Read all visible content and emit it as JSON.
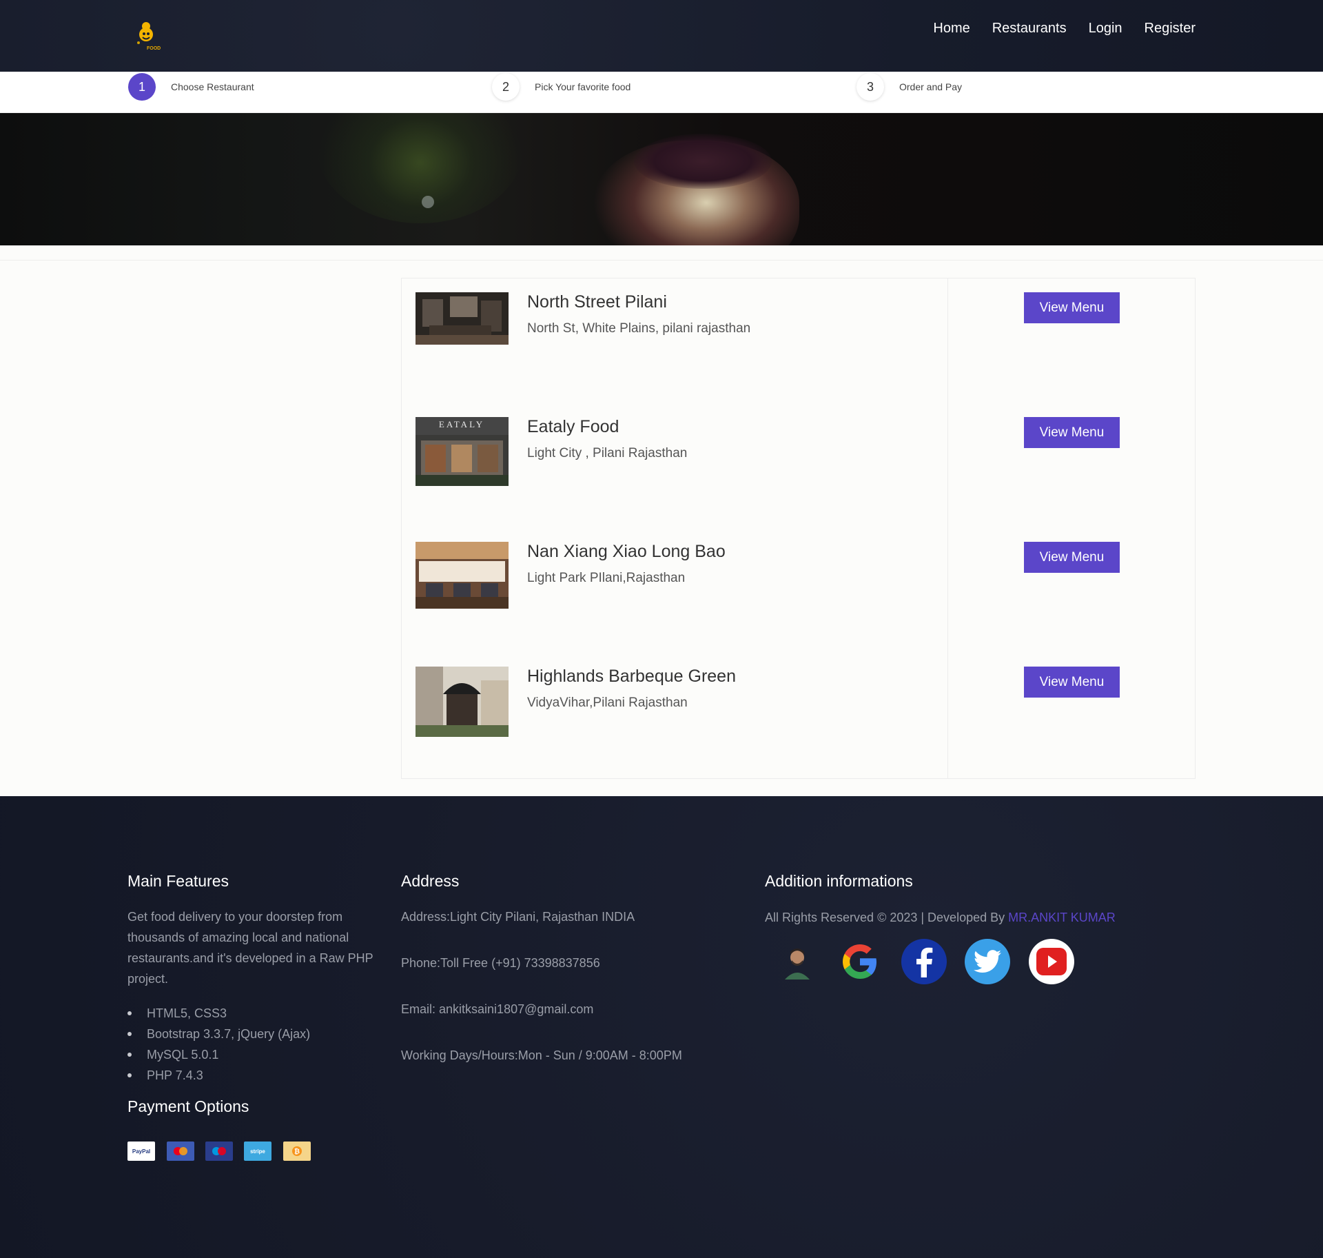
{
  "nav": {
    "links": [
      "Home",
      "Restaurants",
      "Login",
      "Register"
    ],
    "logo_text": "FOOD"
  },
  "steps": [
    {
      "num": "1",
      "label": "Choose Restaurant",
      "active": true
    },
    {
      "num": "2",
      "label": "Pick Your favorite food",
      "active": false
    },
    {
      "num": "3",
      "label": "Order and Pay",
      "active": false
    }
  ],
  "restaurants": [
    {
      "name": "North Street Pilani",
      "address": "North St, White Plains, pilani rajasthan",
      "button": "View Menu"
    },
    {
      "name": "Eataly Food",
      "address": "Light City , Pilani Rajasthan",
      "button": "View Menu",
      "thumb_text": "EATALY"
    },
    {
      "name": "Nan Xiang Xiao Long Bao",
      "address": "Light Park PIlani,Rajasthan",
      "button": "View Menu"
    },
    {
      "name": "Highlands Barbeque Green",
      "address": "VidyaVihar,Pilani Rajasthan",
      "button": "View Menu"
    }
  ],
  "footer": {
    "features": {
      "title": "Main Features",
      "text": "Get food delivery to your doorstep from thousands of amazing local and national restaurants.and it's developed in a Raw PHP project.",
      "items": [
        "HTML5, CSS3",
        "Bootstrap 3.3.7, jQuery (Ajax)",
        "MySQL 5.0.1",
        "PHP 7.4.3"
      ]
    },
    "payment": {
      "title": "Payment Options",
      "methods": [
        {
          "label": "PayPal",
          "icon": "paypal-icon"
        },
        {
          "label": "",
          "icon": "mastercard-icon"
        },
        {
          "label": "",
          "icon": "maestro-icon"
        },
        {
          "label": "stripe",
          "icon": "stripe-icon"
        },
        {
          "label": "",
          "icon": "bitcoin-icon"
        }
      ]
    },
    "address": {
      "title": "Address",
      "lines": [
        "Address:Light City Pilani, Rajasthan INDIA",
        "Phone:Toll Free (+91) 73398837856",
        "Email: ankitksaini1807@gmail.com",
        "Working Days/Hours:Mon - Sun / 9:00AM - 8:00PM"
      ]
    },
    "additional": {
      "title": "Addition informations",
      "rights": "All Rights Reserved © 2023 | Developed By ",
      "developer": "MR.ANKIT KUMAR",
      "social": [
        "avatar",
        "google-icon",
        "facebook-icon",
        "twitter-icon",
        "youtube-icon"
      ]
    }
  },
  "colors": {
    "accent": "#5b46c9",
    "navbar_bg": "#171c2b",
    "footer_bg": "#171b2a"
  }
}
